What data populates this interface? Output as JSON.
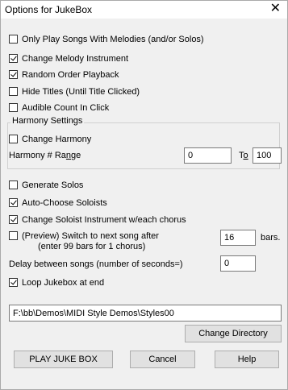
{
  "window": {
    "title": "Options for JukeBox",
    "close_glyph": "✕"
  },
  "options": {
    "only_play_melodies": {
      "label": "Only Play Songs With Melodies (and/or Solos)",
      "checked": false
    },
    "change_melody_instrument": {
      "label": "Change Melody Instrument",
      "checked": true
    },
    "random_order_playback": {
      "label": "Random Order Playback",
      "checked": true
    },
    "hide_titles": {
      "label": "Hide Titles (Until Title Clicked)",
      "checked": false
    },
    "audible_count_in": {
      "label": "Audible Count In Click",
      "checked": false
    }
  },
  "harmony": {
    "group_label": "Harmony Settings",
    "change_harmony": {
      "label": "Change Harmony",
      "checked": false
    },
    "range_label_pre": "Harmony # Ra",
    "range_label_u": "n",
    "range_label_post": "ge",
    "range_from": "0",
    "to_label_pre": "T",
    "to_label_u": "o",
    "range_to": "100"
  },
  "solos": {
    "generate_solos": {
      "label": "Generate Solos",
      "checked": false
    },
    "auto_choose_soloists": {
      "label": "Auto-Choose Soloists",
      "checked": true
    },
    "change_soloist_instrument": {
      "label": "Change Soloist Instrument w/each chorus",
      "checked": true
    }
  },
  "preview": {
    "label_line1": "(Preview) Switch to next song after",
    "label_line2": "(enter 99 bars for 1 chorus)",
    "checked": false,
    "bars_value": "16",
    "bars_unit": "bars."
  },
  "delay": {
    "label": "Delay between songs (number of seconds=)",
    "value": "0"
  },
  "loop": {
    "label": "Loop Jukebox at end",
    "checked": true
  },
  "directory": {
    "path": "F:\\bb\\Demos\\MIDI Style Demos\\Styles00",
    "change_button": "Change Directory"
  },
  "buttons": {
    "play": "PLAY JUKE BOX",
    "cancel": "Cancel",
    "help": "Help"
  }
}
